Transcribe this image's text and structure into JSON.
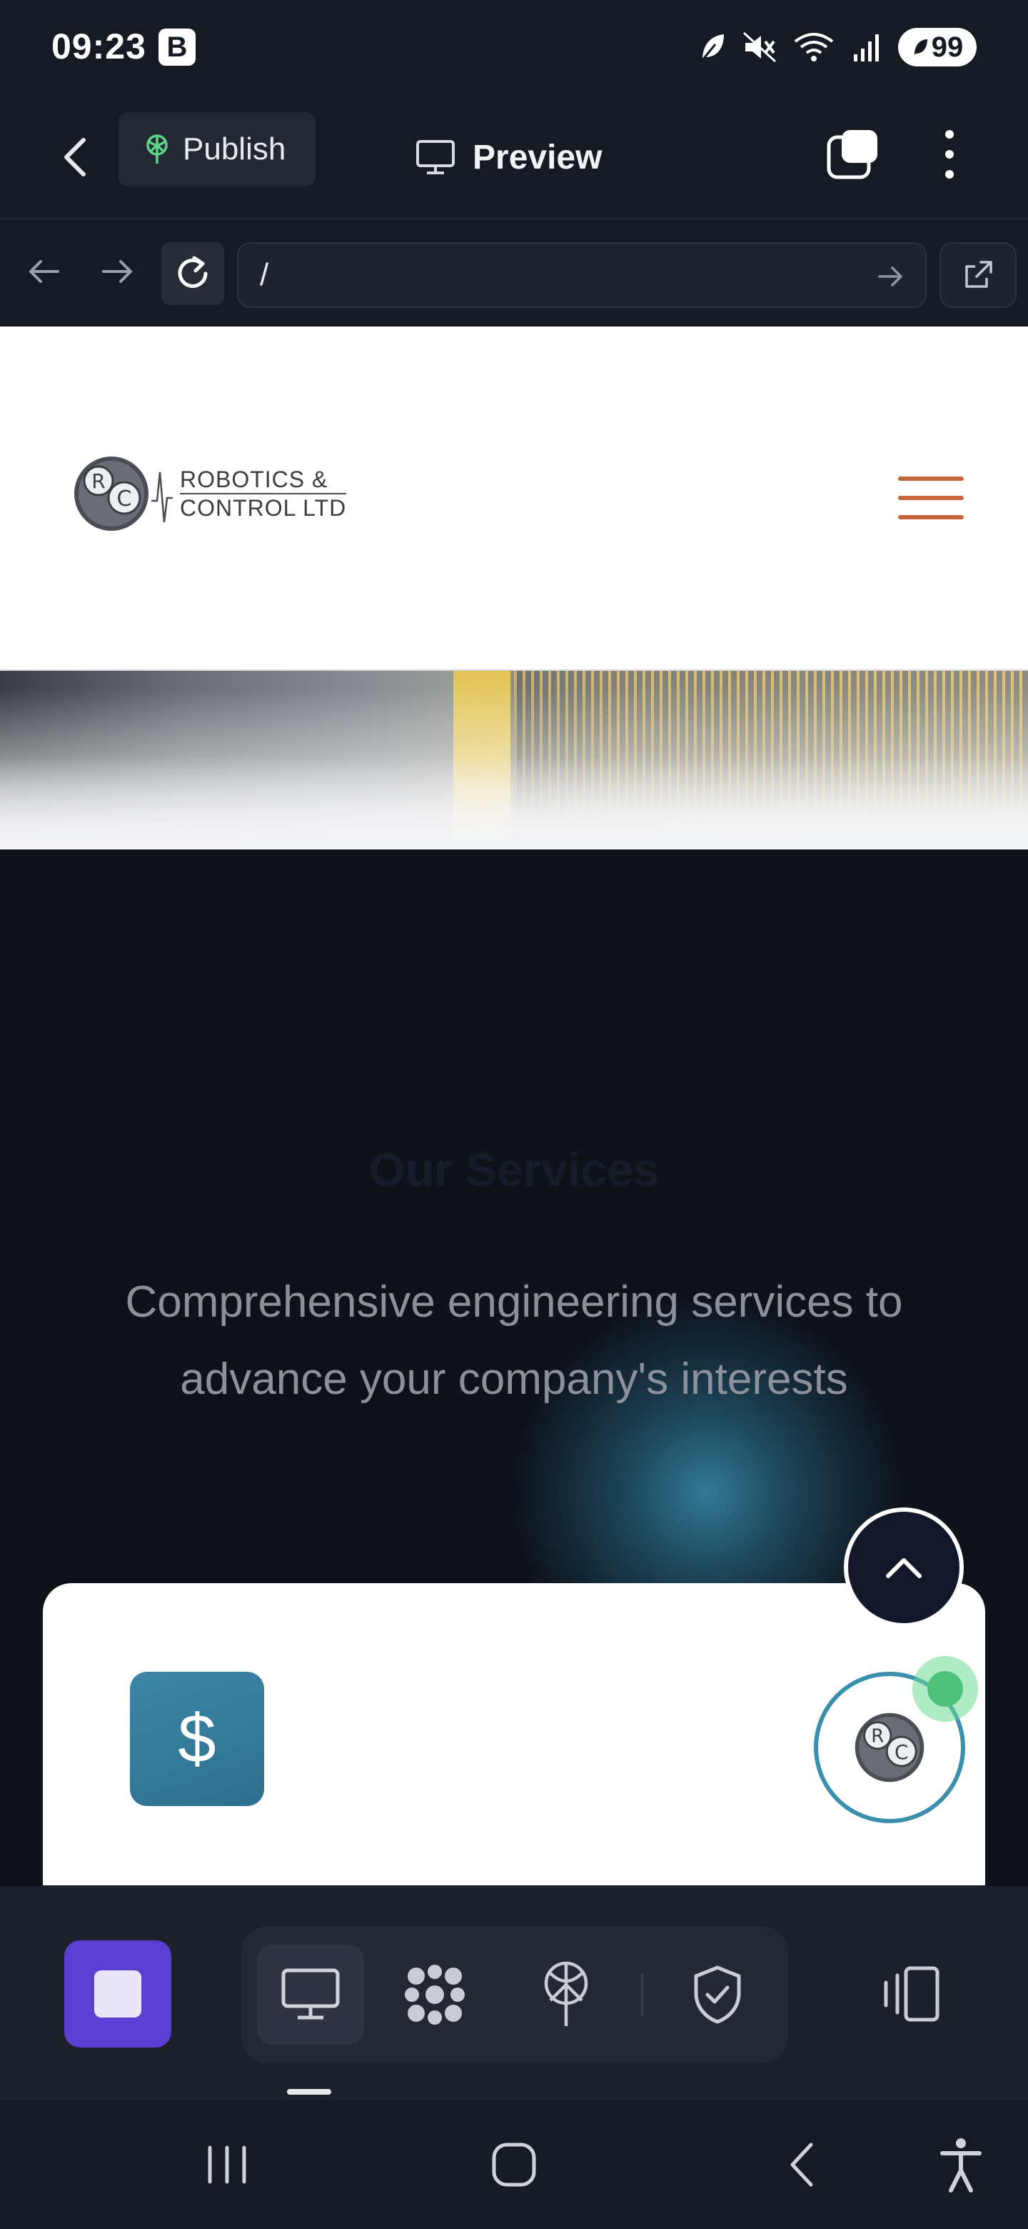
{
  "status_bar": {
    "time": "09:23",
    "b_badge": "B",
    "battery": "99"
  },
  "app_bar": {
    "publish_label": "Publish",
    "preview_label": "Preview"
  },
  "url_bar": {
    "value": "/"
  },
  "website": {
    "logo_text_line1": "ROBOTICS &",
    "logo_text_line2": "CONTROL LTD",
    "services_title": "Our Services",
    "services_subtitle": "Comprehensive engineering services to advance your company's interests",
    "card_icon_symbol": "$"
  },
  "colors": {
    "accent_purple": "#5b3fd3",
    "hamburger_orange": "#c8663b",
    "card_icon_teal": "#3d86a6",
    "online_green": "#4ec27b"
  },
  "icons": {
    "toolbar": [
      "desktop-icon",
      "apps-grid-icon",
      "publish-antenna-icon",
      "shield-check-icon"
    ],
    "side": "device-frames-icon"
  }
}
